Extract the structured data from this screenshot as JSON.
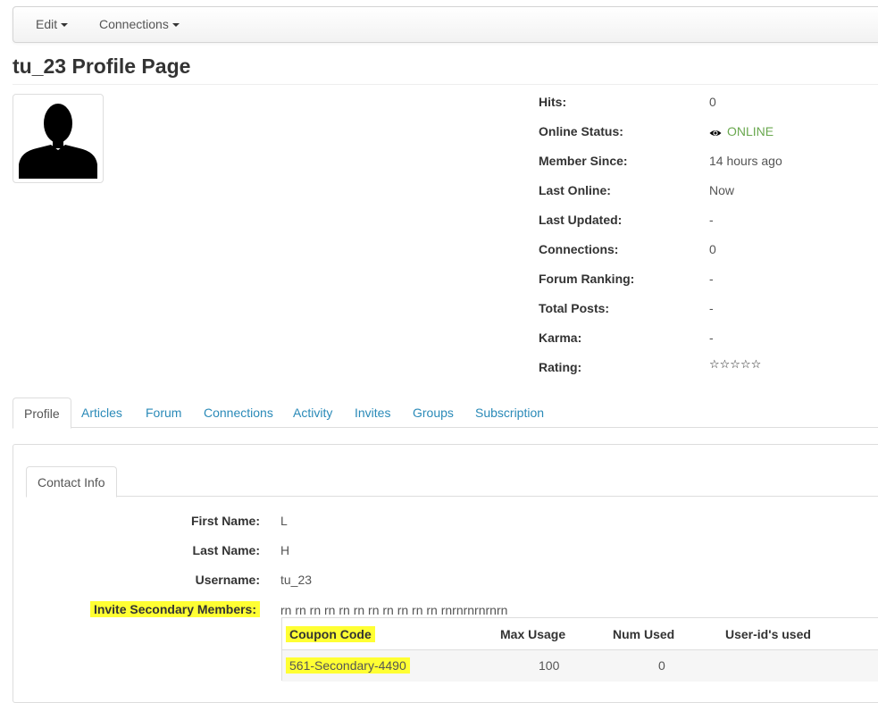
{
  "navbar": {
    "items": [
      {
        "label": "Edit"
      },
      {
        "label": "Connections"
      }
    ]
  },
  "page_title": "tu_23 Profile Page",
  "stats": [
    {
      "label": "Hits:",
      "value": "0"
    },
    {
      "label": "Online Status:",
      "value": "ONLINE"
    },
    {
      "label": "Member Since:",
      "value": "14 hours ago"
    },
    {
      "label": "Last Online:",
      "value": "Now"
    },
    {
      "label": "Last Updated:",
      "value": "-"
    },
    {
      "label": "Connections:",
      "value": "0"
    },
    {
      "label": "Forum Ranking:",
      "value": "-"
    },
    {
      "label": "Total Posts:",
      "value": "-"
    },
    {
      "label": "Karma:",
      "value": "-"
    },
    {
      "label": "Rating:",
      "value": "☆☆☆☆☆",
      "rating": 0,
      "max": 5
    }
  ],
  "tabs": [
    {
      "label": "Profile",
      "active": true
    },
    {
      "label": "Articles"
    },
    {
      "label": "Forum"
    },
    {
      "label": "Connections"
    },
    {
      "label": "Activity"
    },
    {
      "label": "Invites"
    },
    {
      "label": "Groups"
    },
    {
      "label": "Subscription"
    }
  ],
  "contact": {
    "tab_label": "Contact Info",
    "fields": [
      {
        "label": "First Name:",
        "value": "L"
      },
      {
        "label": "Last Name:",
        "value": "H"
      },
      {
        "label": "Username:",
        "value": "tu_23"
      },
      {
        "label": "Invite Secondary Members:",
        "value": "rn rn rn rn rn rn rn rn rn rn rn rnrnrnrnrnrn"
      }
    ]
  },
  "coupon_table": {
    "headers": [
      "Coupon Code",
      "Max Usage",
      "Num Used",
      "User-id's used"
    ],
    "rows": [
      {
        "code": "561-Secondary-4490",
        "max_usage": "100",
        "num_used": "0",
        "user_ids": ""
      }
    ]
  },
  "colors": {
    "link": "#2a8ab8",
    "online": "#6aa84f",
    "highlight": "#ffff33"
  }
}
